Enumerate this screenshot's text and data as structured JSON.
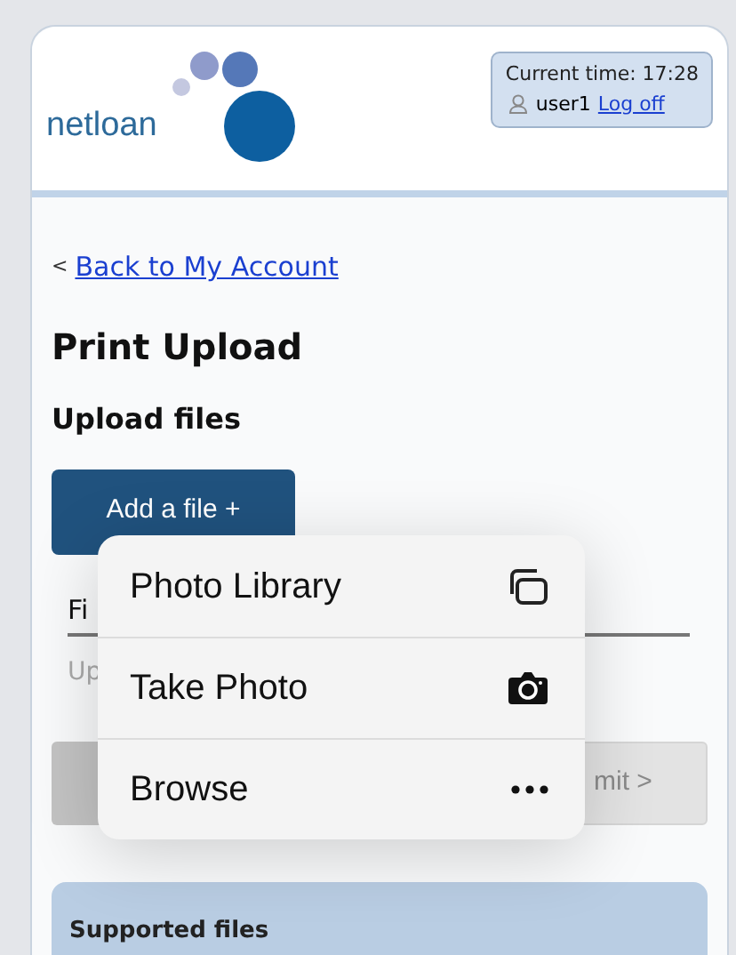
{
  "header": {
    "logo_text": "netloan",
    "session": {
      "time_label": "Current time: 17:28",
      "user": "user1",
      "logoff": "Log off"
    }
  },
  "back_link": {
    "arrow": "<",
    "label": "Back to My Account"
  },
  "title": "Print Upload",
  "subtitle": "Upload files",
  "add_button": "Add a file +",
  "file_label": "Fi",
  "file_hint": "Up",
  "submit_button": {
    "label": "mit >",
    "disabled": true
  },
  "menu": [
    {
      "label": "Photo Library",
      "kind": "library"
    },
    {
      "label": "Take Photo",
      "kind": "camera"
    },
    {
      "label": "Browse",
      "kind": "more"
    }
  ],
  "info_panel": {
    "title": "Supported files"
  }
}
